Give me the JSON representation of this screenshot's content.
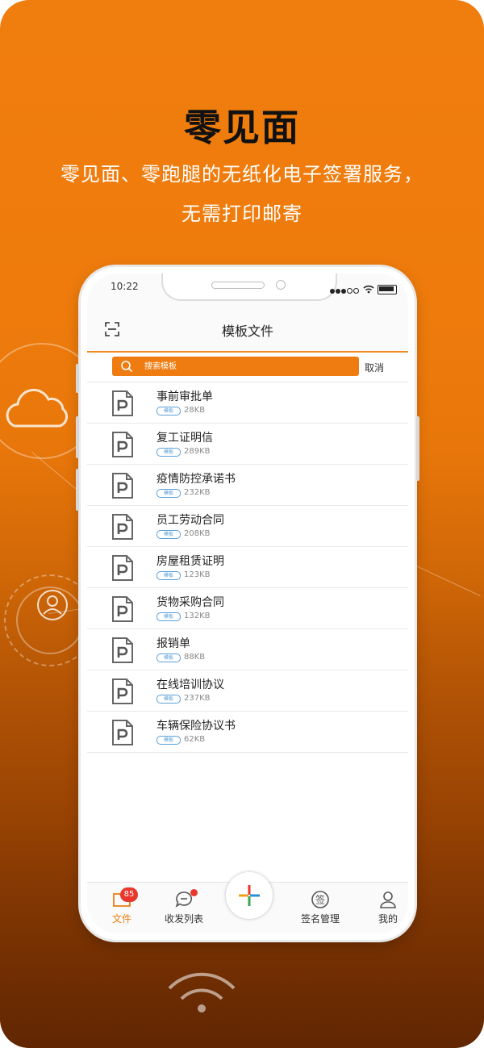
{
  "hero": {
    "title": "零见面",
    "subtitle_line1": "零见面、零跑腿的无纸化电子签署服务，",
    "subtitle_line2": "无需打印邮寄"
  },
  "status": {
    "time": "10:22"
  },
  "nav": {
    "title": "模板文件",
    "scan_icon": "scan-icon"
  },
  "search": {
    "placeholder": "搜索模板",
    "cancel_label": "取消"
  },
  "files": [
    {
      "name": "事前审批单",
      "tag": "模板",
      "size": "28KB"
    },
    {
      "name": "复工证明信",
      "tag": "模板",
      "size": "289KB"
    },
    {
      "name": "疫情防控承诺书",
      "tag": "模板",
      "size": "232KB"
    },
    {
      "name": "员工劳动合同",
      "tag": "模板",
      "size": "208KB"
    },
    {
      "name": "房屋租赁证明",
      "tag": "模板",
      "size": "123KB"
    },
    {
      "name": "货物采购合同",
      "tag": "模板",
      "size": "132KB"
    },
    {
      "name": "报销单",
      "tag": "模板",
      "size": "88KB"
    },
    {
      "name": "在线培训协议",
      "tag": "模板",
      "size": "237KB"
    },
    {
      "name": "车辆保险协议书",
      "tag": "模板",
      "size": "62KB"
    }
  ],
  "tabbar": {
    "files_label": "文件",
    "files_badge": "85",
    "inbox_label": "收发列表",
    "sign_label": "签名管理",
    "sign_glyph": "签",
    "me_label": "我的"
  },
  "colors": {
    "accent": "#ee7c10",
    "badge": "#e8372c",
    "tag": "#5b9fd8"
  }
}
